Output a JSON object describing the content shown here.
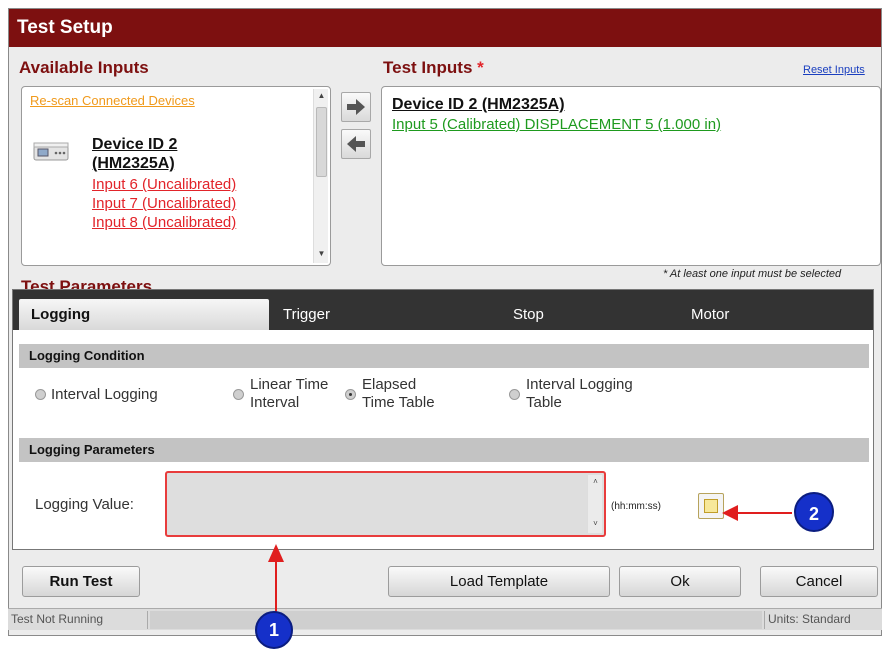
{
  "window": {
    "title": "Test Setup"
  },
  "available_inputs": {
    "label": "Available Inputs",
    "rescan_link": "Re-scan Connected Devices",
    "device_name": "Device ID 2 (HM2325A)",
    "items": [
      "Input 6 (Uncalibrated)",
      "Input 7 (Uncalibrated)",
      "Input 8 (Uncalibrated)"
    ]
  },
  "transfer": {
    "add_icon": "arrow-right-icon",
    "remove_icon": "arrow-left-icon"
  },
  "test_inputs": {
    "label": "Test Inputs",
    "required_marker": "*",
    "reset_link": "Reset Inputs",
    "device_name": "Device ID 2 (HM2325A)",
    "items": [
      "Input 5 (Calibrated) DISPLACEMENT 5 (1.000 in)"
    ],
    "note": "* At least one input must be selected"
  },
  "test_parameters": {
    "label": "Test Parameters",
    "tabs": [
      "Logging",
      "Trigger",
      "Stop",
      "Motor"
    ],
    "active_tab": "Logging",
    "logging_condition": {
      "header": "Logging Condition",
      "options": [
        {
          "label": "Interval Logging",
          "checked": false
        },
        {
          "label": "Linear Time Interval",
          "checked": false
        },
        {
          "label": "Elapsed Time Table",
          "checked": true
        },
        {
          "label": "Interval Logging Table",
          "checked": false
        }
      ]
    },
    "logging_parameters": {
      "header": "Logging Parameters",
      "value_label": "Logging Value:",
      "value": "",
      "units": "(hh:mm:ss)",
      "picker_icon": "table-icon"
    }
  },
  "buttons": {
    "run_test": "Run Test",
    "load_template": "Load Template",
    "ok": "Ok",
    "cancel": "Cancel"
  },
  "status": {
    "state": "Test Not Running",
    "units": "Units: Standard"
  },
  "callouts": {
    "one": "1",
    "two": "2",
    "color": "#e01e1e",
    "marker_color": "#1530c9"
  },
  "colors": {
    "title_bar": "#7d1010",
    "uncalibrated": "#e2242a",
    "calibrated": "#1e9a1e",
    "rescan_link": "#f09a1c"
  }
}
